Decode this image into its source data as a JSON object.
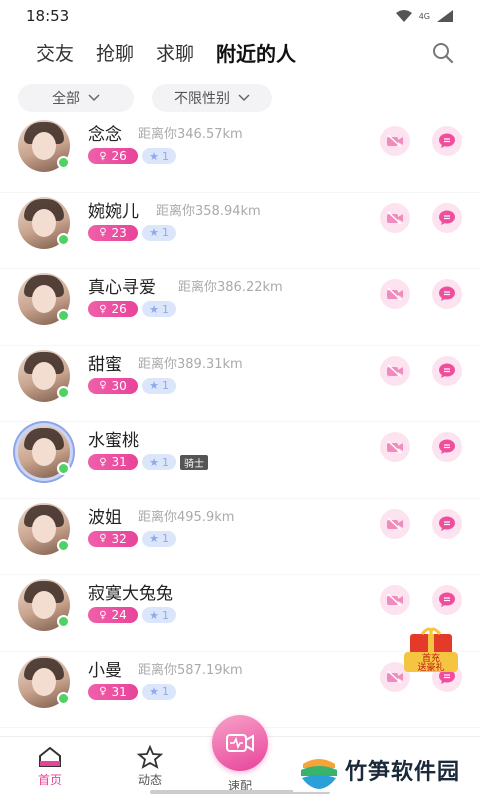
{
  "status": {
    "time": "18:53",
    "network": "4G"
  },
  "tabs": [
    {
      "label": "交友"
    },
    {
      "label": "抢聊"
    },
    {
      "label": "求聊"
    },
    {
      "label": "附近的人",
      "active": true
    }
  ],
  "filters": [
    {
      "label": "全部"
    },
    {
      "label": "不限性别"
    }
  ],
  "users": [
    {
      "name": "念念",
      "distance": "距离你346.57km",
      "age": "26",
      "level": "1",
      "online": true
    },
    {
      "name": "婉婉儿",
      "distance": "距离你358.94km",
      "age": "23",
      "level": "1",
      "online": true
    },
    {
      "name": "真心寻爱",
      "distance": "距离你386.22km",
      "age": "26",
      "level": "1",
      "online": true
    },
    {
      "name": "甜蜜",
      "distance": "距离你389.31km",
      "age": "30",
      "level": "1",
      "online": true
    },
    {
      "name": "水蜜桃",
      "distance": "",
      "age": "31",
      "level": "1",
      "online": true,
      "badge": "骑士"
    },
    {
      "name": "波姐",
      "distance": "距离你495.9km",
      "age": "32",
      "level": "1",
      "online": true
    },
    {
      "name": "寂寞大兔兔",
      "distance": "",
      "age": "24",
      "level": "1",
      "online": true
    },
    {
      "name": "小曼",
      "distance": "距离你587.19km",
      "age": "31",
      "level": "1",
      "online": true
    }
  ],
  "gift": {
    "line1": "首充",
    "line2": "送豪礼"
  },
  "nav": {
    "home": "首页",
    "dynamic": "动态",
    "match": "速配"
  },
  "watermark": "竹笋软件园",
  "colors": {
    "accent": "#e8439a",
    "online": "#4fd164",
    "level_bg": "#dbe6fb"
  },
  "icons": {
    "video": "video-off-icon",
    "chat": "chat-icon",
    "search": "search-icon"
  }
}
